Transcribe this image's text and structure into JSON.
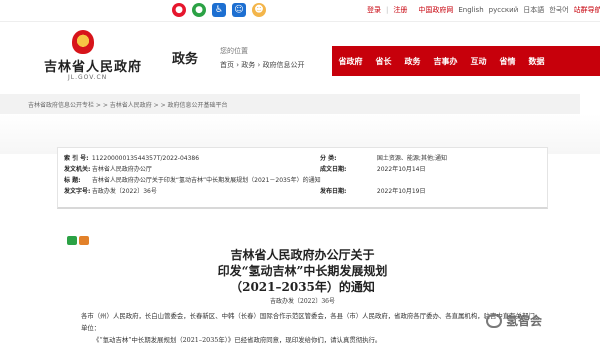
{
  "topbar": {
    "icons": [
      "weibo-icon",
      "wechat-icon",
      "accessibility-icon",
      "elder-mode-icon",
      "mascot-icon"
    ],
    "links": {
      "login": "登录",
      "register": "注册",
      "china_gov": "中国政府网",
      "english": "English",
      "russian": "русский",
      "japanese": "日本語",
      "korean": "한국어",
      "sitemap": "站群导航"
    }
  },
  "header": {
    "site_title": "吉林省人民政府",
    "site_domain": "JL.GOV.CN",
    "section": "政务",
    "position_label": "您的位置",
    "breadcrumb": [
      "首页",
      "政务",
      "政府信息公开"
    ],
    "breadcrumb_sep": "›"
  },
  "nav": {
    "items": [
      "省政府",
      "省长",
      "政务",
      "吉事办",
      "互动",
      "省情",
      "数据"
    ]
  },
  "band": {
    "path": "吉林省政府信息公开专栏 > > 吉林省人民政府 > > 政府信息公开基础平台"
  },
  "info": {
    "index_label": "索 引 号:",
    "index_value": "11220000013544357T/2022-04386",
    "category_label": "分  类:",
    "category_value": "国土资源、能源;其他;通知",
    "issuer_label": "发文机关:",
    "issuer_value": "吉林省人民政府办公厅",
    "created_label": "成文日期:",
    "created_value": "2022年10月14日",
    "title_label": "标  题:",
    "title_value": "吉林省人民政府办公厅关于印发“氢动吉林”中长期发展规划（2021－2035年）的通知",
    "docno_label": "发文字号:",
    "docno_value": "吉政办发〔2022〕36号",
    "published_label": "发布日期:",
    "published_value": "2022年10月19日"
  },
  "article": {
    "title_line1": "吉林省人民政府办公厅关于",
    "title_line2": "印发“氢动吉林”中长期发展规划",
    "title_line3": "（2021–2035年）的通知",
    "doc_number": "吉政办发〔2022〕36号",
    "para1": "各市（州）人民政府，长白山管委会，长春新区、中韩（长春）国际合作示范区管委会，各县（市）人民政府，省政府各厅委办、各直属机构，驻吉中直有关部门、单位：",
    "para2": "《“氢动吉林”中长期发展规划（2021–2035年）》已经省政府同意，现印发给你们，请认真贯彻执行。"
  },
  "watermark": {
    "text": "氢智会"
  },
  "colors": {
    "brand_red": "#c7000b",
    "band_gray": "#f2f2f2"
  }
}
